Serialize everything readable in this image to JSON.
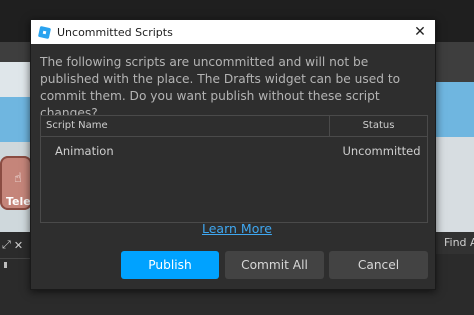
{
  "background": {
    "teleport_label": "Tele",
    "right_panel_label": "Find A"
  },
  "dialog": {
    "title": "Uncommitted Scripts",
    "message": "The following scripts are uncommitted and will not be published with the place. The Drafts widget can be used to commit them. Do you want publish without these script changes?",
    "table": {
      "columns": [
        "Script Name",
        "Status"
      ],
      "rows": [
        {
          "name": "Animation",
          "status": "Uncommitted"
        }
      ]
    },
    "learn_more": "Learn More",
    "buttons": {
      "publish": "Publish",
      "commit_all": "Commit All",
      "cancel": "Cancel"
    }
  },
  "colors": {
    "accent": "#00a2ff",
    "link": "#3fa7f0",
    "dialog_bg": "#2e2e2e",
    "secondary_button": "#434343"
  },
  "icons": [
    "studio-app-icon",
    "close-icon",
    "teleport-icon"
  ]
}
